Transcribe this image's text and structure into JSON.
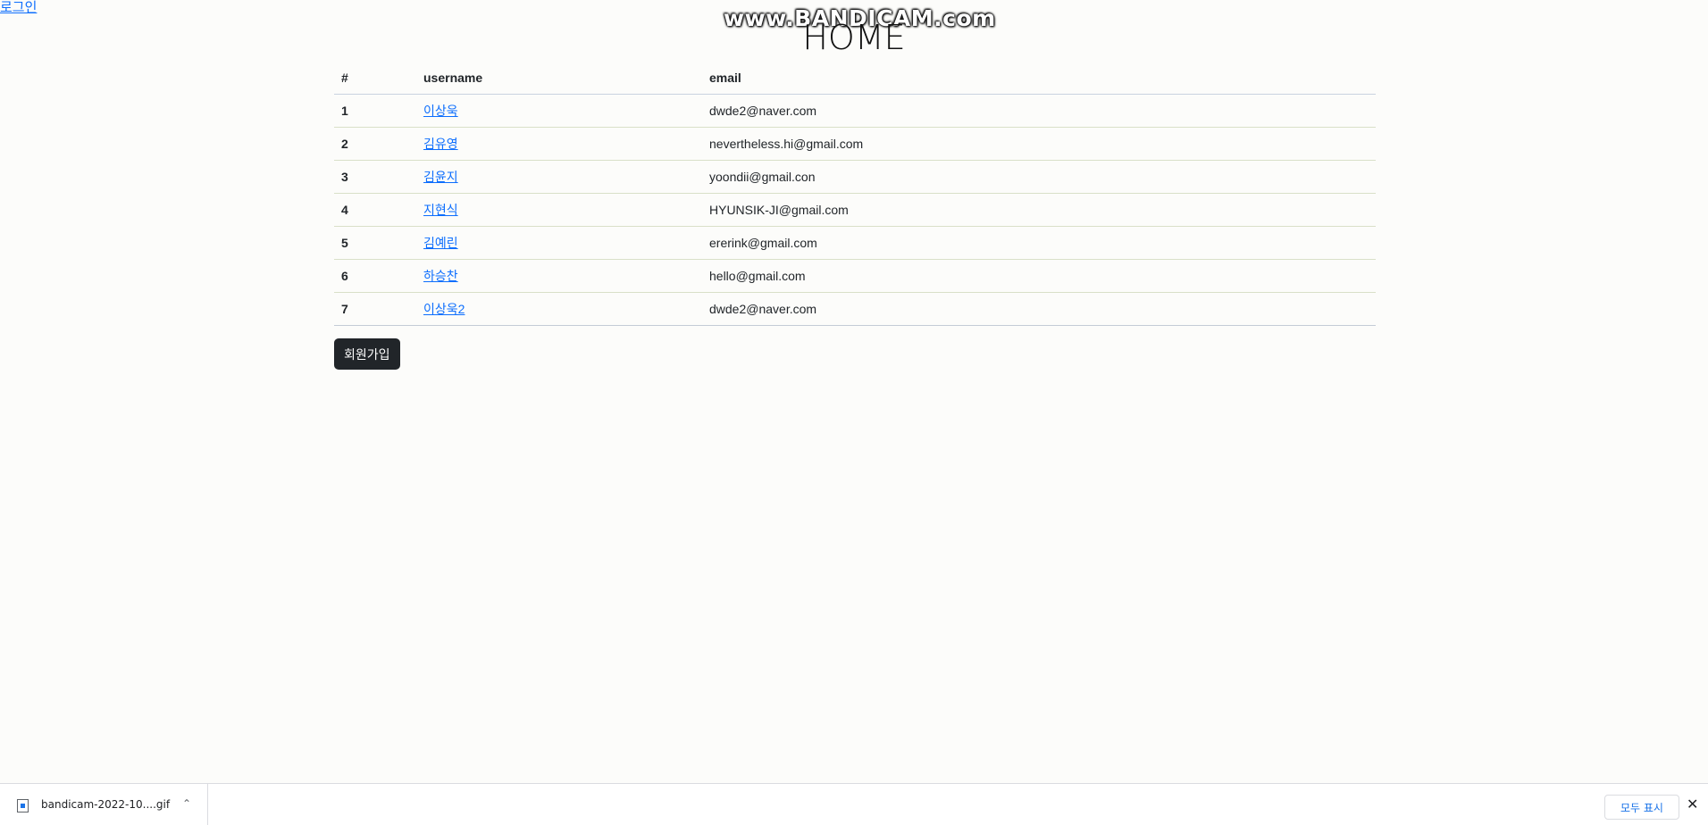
{
  "nav": {
    "login_label": "로그인"
  },
  "watermark": {
    "text": "www.BANDICAM.com"
  },
  "page_title": "HOME",
  "table": {
    "headers": [
      "#",
      "username",
      "email"
    ],
    "rows": [
      {
        "num": "1",
        "username": "이상욱",
        "email": "dwde2@naver.com"
      },
      {
        "num": "2",
        "username": "김유영",
        "email": "nevertheless.hi@gmail.com"
      },
      {
        "num": "3",
        "username": "김윤지",
        "email": "yoondii@gmail.con"
      },
      {
        "num": "4",
        "username": "지현식",
        "email": "HYUNSIK-JI@gmail.com"
      },
      {
        "num": "5",
        "username": "김예린",
        "email": "ererink@gmail.com"
      },
      {
        "num": "6",
        "username": "하승찬",
        "email": "hello@gmail.com"
      },
      {
        "num": "7",
        "username": "이상욱2",
        "email": "dwde2@naver.com"
      }
    ]
  },
  "signup_label": "회원가입",
  "download_bar": {
    "file_name": "bandicam-2022-10....gif",
    "show_all_label": "모두 표시",
    "chevron_icon": "chevron-up-icon",
    "close_icon": "close-icon"
  }
}
